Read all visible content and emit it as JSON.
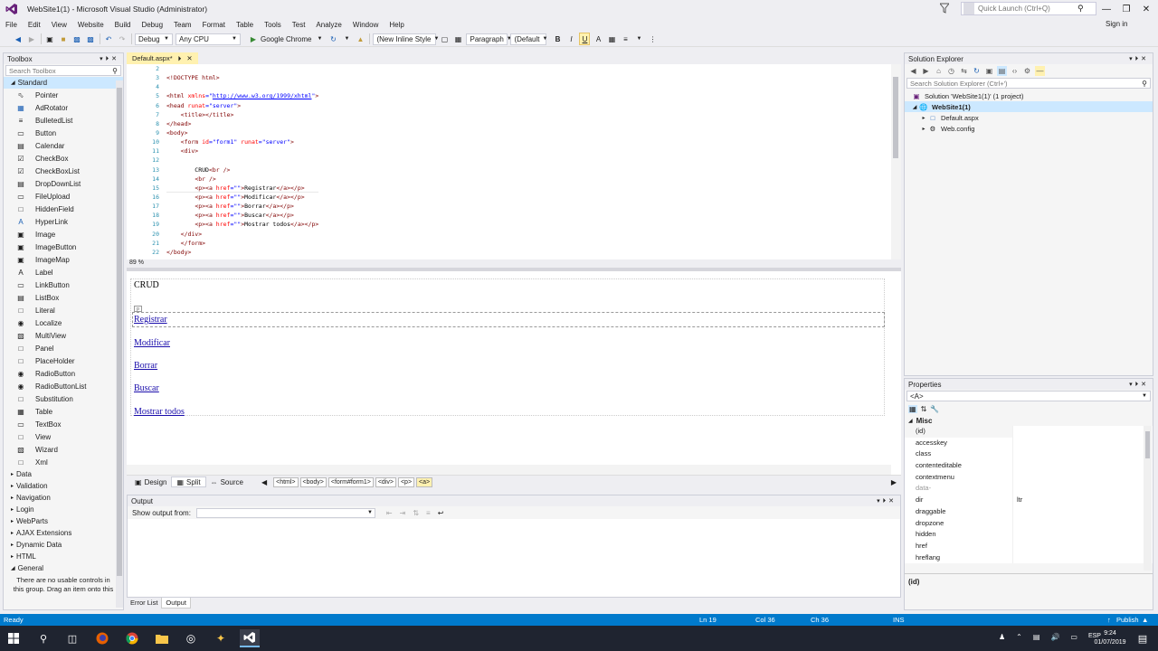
{
  "window": {
    "title": "WebSite1(1) - Microsoft Visual Studio (Administrator)",
    "quick_launch_placeholder": "Quick Launch (Ctrl+Q)",
    "sign_in": "Sign in"
  },
  "menu": [
    "File",
    "Edit",
    "View",
    "Website",
    "Build",
    "Debug",
    "Team",
    "Format",
    "Table",
    "Tools",
    "Test",
    "Analyze",
    "Window",
    "Help"
  ],
  "toolbar": {
    "config": "Debug",
    "platform": "Any CPU",
    "run_target": "Google Chrome",
    "style": "(New Inline Style",
    "block_format": "Paragraph",
    "font": "(Default",
    "bold": "B",
    "italic": "I",
    "underline": "U"
  },
  "toolbox": {
    "title": "Toolbox",
    "search_placeholder": "Search Toolbox",
    "standard_label": "Standard",
    "items": [
      "Pointer",
      "AdRotator",
      "BulletedList",
      "Button",
      "Calendar",
      "CheckBox",
      "CheckBoxList",
      "DropDownList",
      "FileUpload",
      "HiddenField",
      "HyperLink",
      "Image",
      "ImageButton",
      "ImageMap",
      "Label",
      "LinkButton",
      "ListBox",
      "Literal",
      "Localize",
      "MultiView",
      "Panel",
      "PlaceHolder",
      "RadioButton",
      "RadioButtonList",
      "Substitution",
      "Table",
      "TextBox",
      "View",
      "Wizard",
      "Xml"
    ],
    "categories": [
      "Data",
      "Validation",
      "Navigation",
      "Login",
      "WebParts",
      "AJAX Extensions",
      "Dynamic Data",
      "HTML"
    ],
    "general_label": "General",
    "empty_msg": "There are no usable controls in this group. Drag an item onto this text to add it to the"
  },
  "editor": {
    "tab_label": "Default.aspx*",
    "zoom": "89 %",
    "line_numbers": [
      "2",
      "3",
      "4",
      "5",
      "6",
      "7",
      "8",
      "9",
      "10",
      "11",
      "12",
      "13",
      "14",
      "15",
      "16",
      "17",
      "18",
      "19",
      "20",
      "21",
      "22"
    ]
  },
  "design": {
    "crud": "CRUD",
    "p_tag": "p",
    "links": [
      "Registrar",
      "Modificar",
      "Borrar",
      "Buscar",
      "Mostrar todos"
    ]
  },
  "viewbar": {
    "design": "Design",
    "split": "Split",
    "source": "Source",
    "crumbs": [
      "<html>",
      "<body>",
      "<form#form1>",
      "<div>",
      "<p>",
      "<a>"
    ]
  },
  "output": {
    "title": "Output",
    "show_from": "Show output from:",
    "tabs": [
      "Error List",
      "Output"
    ]
  },
  "solution_explorer": {
    "title": "Solution Explorer",
    "search_placeholder": "Search Solution Explorer (Ctrl+')",
    "nodes": [
      "Solution 'WebSite1(1)' (1 project)",
      "WebSite1(1)",
      "Default.aspx",
      "Web.config"
    ]
  },
  "properties": {
    "title": "Properties",
    "object": "<A>",
    "category": "Misc",
    "rows": [
      {
        "name": "(id)",
        "value": ""
      },
      {
        "name": "accesskey",
        "value": ""
      },
      {
        "name": "class",
        "value": ""
      },
      {
        "name": "contenteditable",
        "value": ""
      },
      {
        "name": "contextmenu",
        "value": ""
      },
      {
        "name": "data-",
        "value": ""
      },
      {
        "name": "dir",
        "value": "ltr"
      },
      {
        "name": "draggable",
        "value": ""
      },
      {
        "name": "dropzone",
        "value": ""
      },
      {
        "name": "hidden",
        "value": ""
      },
      {
        "name": "href",
        "value": ""
      },
      {
        "name": "hreflang",
        "value": ""
      }
    ],
    "desc": "(id)"
  },
  "status": {
    "state": "Ready",
    "ln": "Ln 19",
    "col": "Col 36",
    "ch": "Ch 36",
    "ins": "INS",
    "publish": "Publish"
  },
  "taskbar": {
    "time": "9:24",
    "date": "01/07/2019",
    "lang": "ESP"
  },
  "colors": {
    "accent": "#007acc",
    "vs_purple": "#68217a",
    "tab_active": "#fff1b0"
  }
}
